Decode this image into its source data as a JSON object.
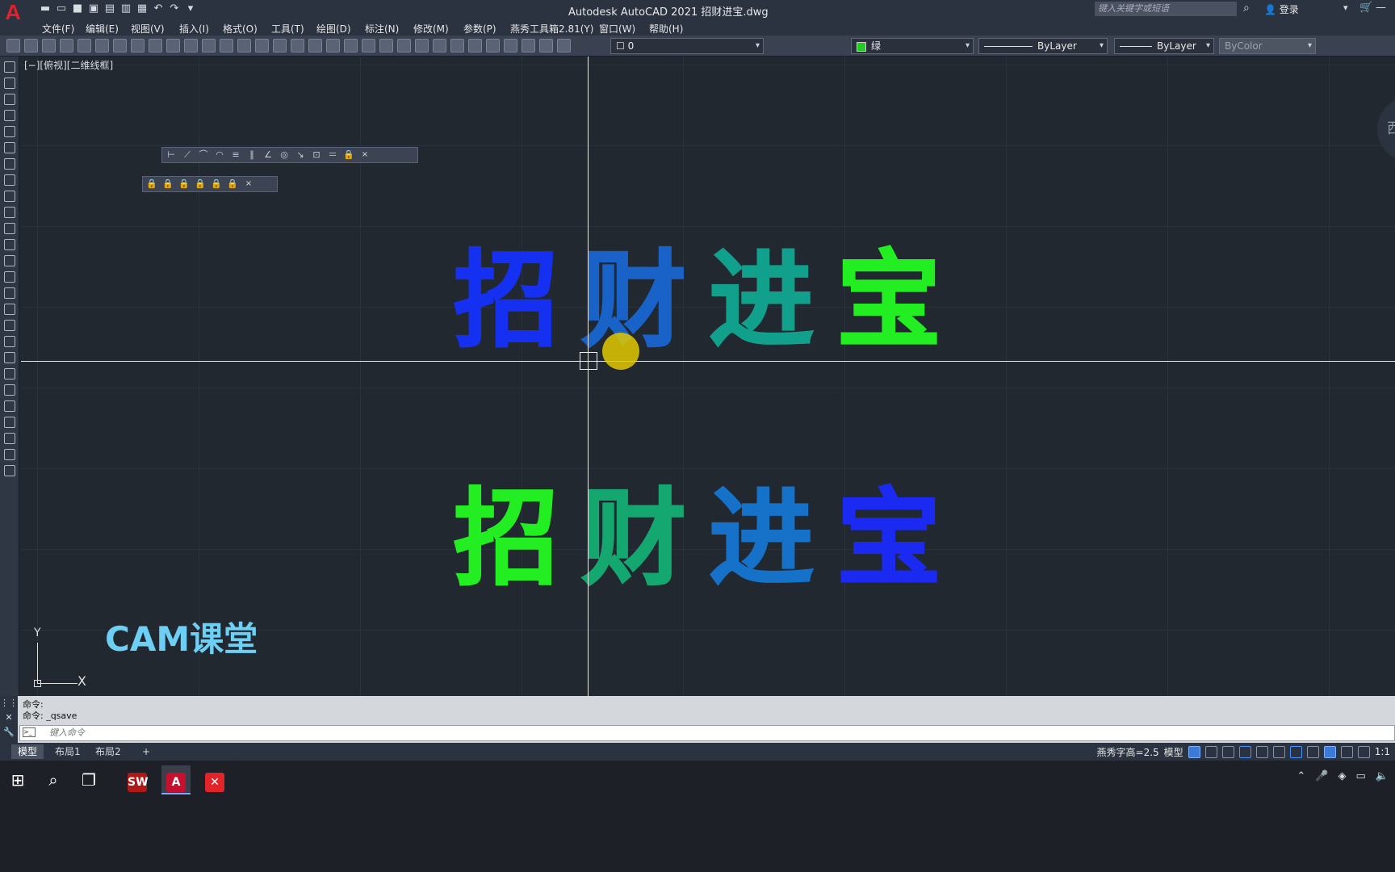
{
  "app": {
    "logo": "A",
    "title": "Autodesk AutoCAD 2021   招财进宝.dwg",
    "search_placeholder": "键入关键字或短语",
    "login": "登录"
  },
  "menu": [
    "文件(F)",
    "编辑(E)",
    "视图(V)",
    "插入(I)",
    "格式(O)",
    "工具(T)",
    "绘图(D)",
    "标注(N)",
    "修改(M)",
    "参数(P)",
    "燕秀工具箱2.81(Y)",
    "窗口(W)",
    "帮助(H)"
  ],
  "toolbar": {
    "layer_value": "0",
    "color_value": "绿",
    "color_hex": "#22cc22",
    "linetype_value": "ByLayer",
    "lineweight_value": "ByLayer",
    "plotstyle_value": "ByColor"
  },
  "canvas": {
    "view_label": "[−][俯视][二维线框]",
    "viewcube_label": "西",
    "text_row1": [
      "招",
      "财",
      "进",
      "宝"
    ],
    "text_row1_colors": [
      "#1530f0",
      "#1862c8",
      "#10a08c",
      "#22ee22"
    ],
    "text_row2": [
      "招",
      "财",
      "进",
      "宝"
    ],
    "text_row2_colors": [
      "#22ee22",
      "#14a870",
      "#1672c8",
      "#1a2af0"
    ],
    "watermark": "CAM课堂",
    "ucs_x": "X",
    "ucs_y": "Y"
  },
  "command": {
    "history_1": "命令:",
    "history_2": "命令: _qsave",
    "placeholder": "键入命令"
  },
  "tabs": [
    "模型",
    "布局1",
    "布局2",
    "+"
  ],
  "status": {
    "text_height": "燕秀字高=2.5",
    "mode": "模型",
    "scale": "1:1"
  },
  "taskbar": {
    "solidworks_label": "SW",
    "acad_label": "A",
    "x_label": "✕"
  }
}
